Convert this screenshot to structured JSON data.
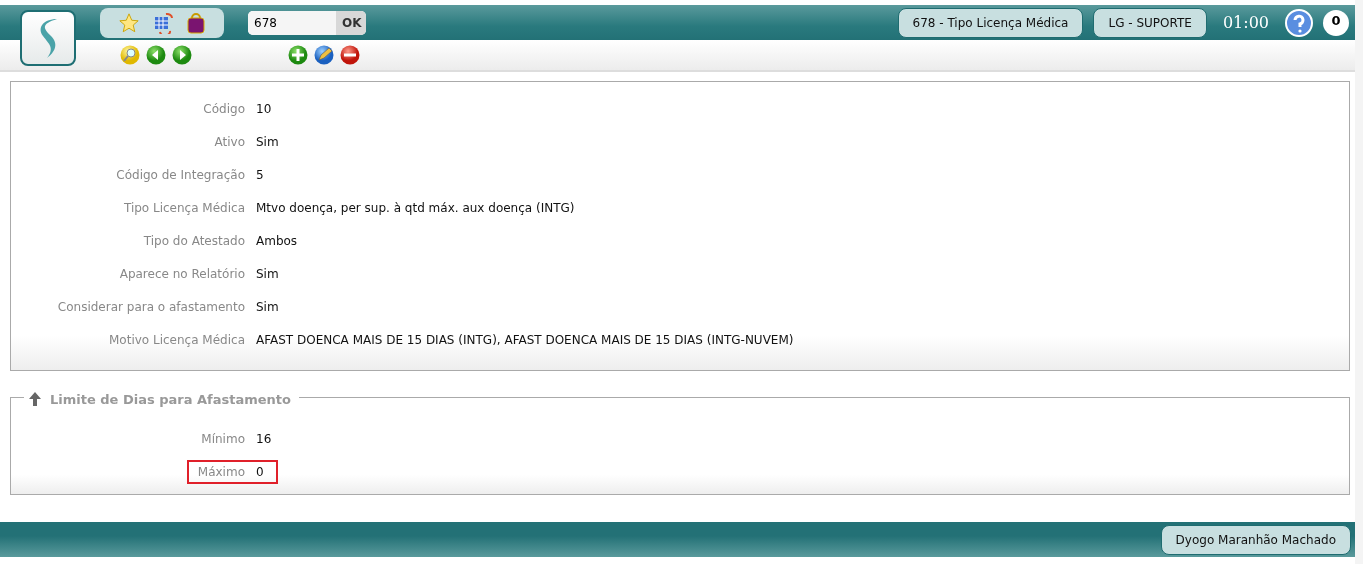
{
  "header": {
    "search": {
      "value": "678",
      "button": "OK"
    },
    "screen_button": "678 - Tipo Licença Médica",
    "user_group_button": "LG - SUPORTE",
    "time": "01:00",
    "notifications": "0"
  },
  "details": [
    {
      "label": "Código",
      "value": "10",
      "highlighted": false
    },
    {
      "label": "Ativo",
      "value": "Sim",
      "highlighted": false
    },
    {
      "label": "Código de Integração",
      "value": "5",
      "highlighted": false
    },
    {
      "label": "Tipo Licença Médica",
      "value": "Mtvo doença, per sup. à qtd máx. aux doença (INTG)",
      "highlighted": false
    },
    {
      "label": "Tipo do Atestado",
      "value": "Ambos",
      "highlighted": false
    },
    {
      "label": "Aparece no Relatório",
      "value": "Sim",
      "highlighted": false
    },
    {
      "label": "Considerar para o afastamento",
      "value": "Sim",
      "highlighted": false
    },
    {
      "label": "Motivo Licença Médica",
      "value": "AFAST DOENCA MAIS DE 15 DIAS (INTG), AFAST DOENCA MAIS DE 15 DIAS (INTG-NUVEM)",
      "highlighted": false
    }
  ],
  "limits": {
    "title": "Limite de Dias para Afastamento",
    "fields": [
      {
        "label": "Mínimo",
        "value": "16",
        "highlighted": false
      },
      {
        "label": "Máximo",
        "value": "0",
        "highlighted": true
      }
    ]
  },
  "footer": {
    "user": "Dyogo Maranhão Machado"
  }
}
